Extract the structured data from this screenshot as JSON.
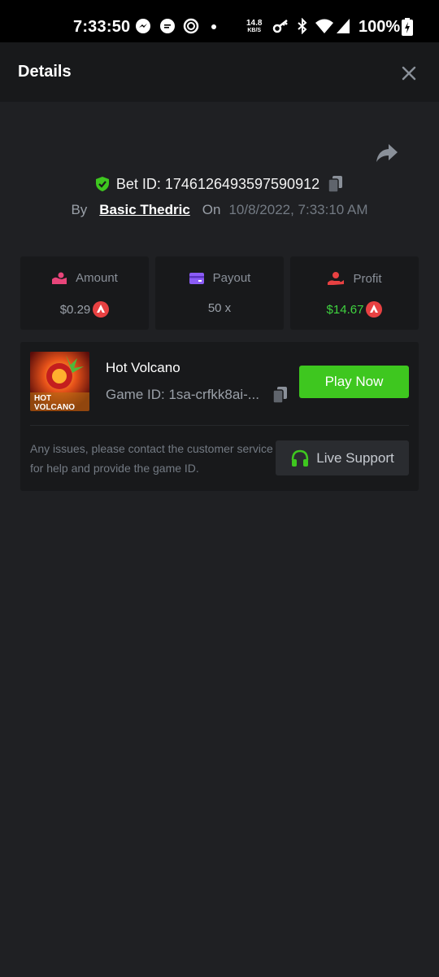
{
  "status_bar": {
    "time": "7:33:50",
    "net_speed": "14.8",
    "net_unit": "KB/S",
    "battery": "100%"
  },
  "header": {
    "title": "Details"
  },
  "bet": {
    "id_text": "Bet ID: 1746126493597590912",
    "by_label": "By",
    "user": "Basic Thedric",
    "on_label": "On",
    "date": "10/8/2022, 7:33:10 AM"
  },
  "stats": {
    "amount": {
      "label": "Amount",
      "value": "$0.29"
    },
    "payout": {
      "label": "Payout",
      "value": "50 x"
    },
    "profit": {
      "label": "Profit",
      "value": "$14.67"
    }
  },
  "game": {
    "name": "Hot Volcano",
    "id_text": "Game ID: 1sa-crfkk8ai-...",
    "thumb_line1": "HOT",
    "thumb_line2": "VOLCANO",
    "play_label": "Play Now",
    "help": "Any issues, please contact the customer service for help and provide the game ID.",
    "support_label": "Live Support"
  },
  "colors": {
    "accent_green": "#3ec71f",
    "profit_green": "#3fd33f",
    "currency_red": "#e84142"
  }
}
